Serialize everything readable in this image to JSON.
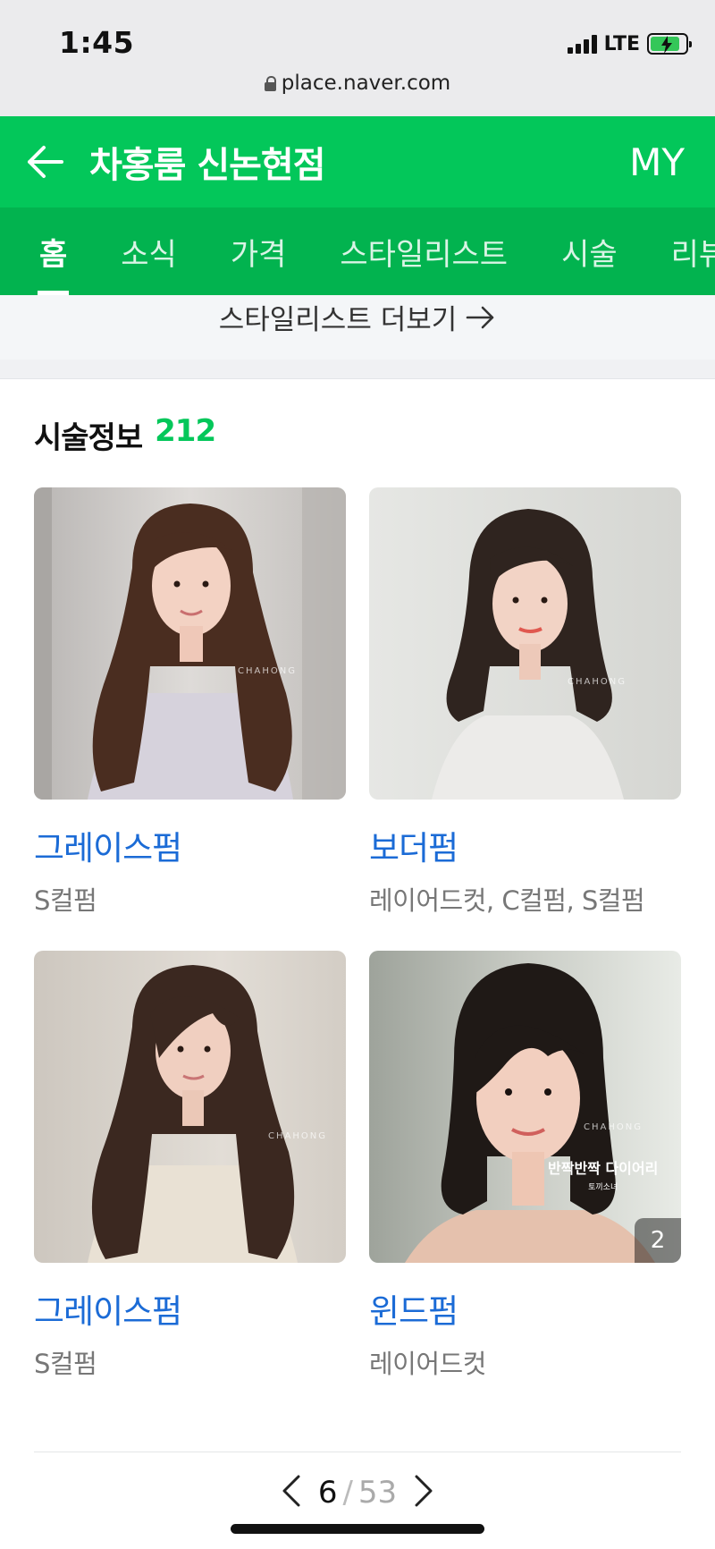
{
  "status_bar": {
    "time": "1:45",
    "network": "LTE",
    "battery_color": "#34c759",
    "url": "place.naver.com"
  },
  "header": {
    "title": "차홍룸 신논현점",
    "my_label": "MY",
    "background": "#03c75a"
  },
  "tabs": [
    {
      "label": "홈",
      "active": true
    },
    {
      "label": "소식",
      "active": false
    },
    {
      "label": "가격",
      "active": false
    },
    {
      "label": "스타일리스트",
      "active": false
    },
    {
      "label": "시술",
      "active": false
    },
    {
      "label": "리뷰",
      "active": false
    }
  ],
  "stylist_more": {
    "label": "스타일리스트 더보기"
  },
  "section": {
    "title": "시술정보",
    "count": "212",
    "count_color": "#03c75a"
  },
  "cards": [
    {
      "title": "그레이스펌",
      "subtitle": "S컬펌",
      "watermark": "CHAHONG"
    },
    {
      "title": "보더펌",
      "subtitle": "레이어드컷, C컬펌, S컬펌",
      "watermark": "CHAHONG"
    },
    {
      "title": "그레이스펌",
      "subtitle": "S컬펌",
      "watermark": "CHAHONG"
    },
    {
      "title": "윈드펌",
      "subtitle": "레이어드컷",
      "watermark": "CHAHONG",
      "overlay_title": "반짝반짝 다이어리",
      "overlay_sub": "토끼소녀",
      "badge": "2"
    }
  ],
  "pager": {
    "current": "6",
    "separator": "/",
    "total": "53"
  },
  "link_color": "#1b6bd6"
}
